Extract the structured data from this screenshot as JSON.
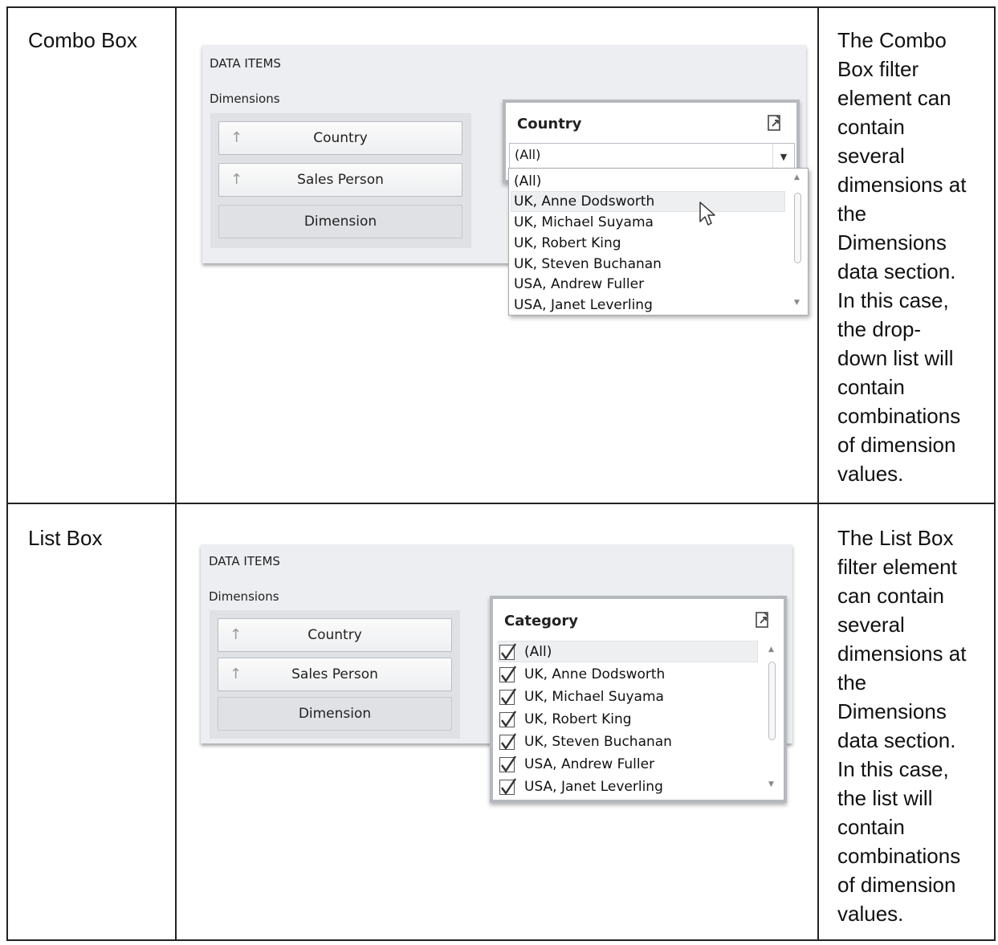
{
  "rows": [
    {
      "name": "Combo Box",
      "description": "The Combo Box filter element can contain several dimensions at the Dimensions data section. In this case, the drop-down list will contain combinations of dimension values.",
      "description_lines": [
        "The Combo",
        "Box filter",
        "element can",
        "contain",
        "several",
        "dimensions at",
        "the",
        "Dimensions",
        "data section.",
        "In this case,",
        "the drop-",
        "down list will",
        "contain",
        "combinations",
        "of dimension",
        "values."
      ],
      "panel": {
        "data_items_title": "DATA ITEMS",
        "dimensions_label": "Dimensions",
        "dimension_buttons": [
          "Country",
          "Sales Person"
        ],
        "dimension_placeholder": "Dimension",
        "filter_title": "Country",
        "selected_value": "(All)",
        "items": [
          "(All)",
          "UK, Anne Dodsworth",
          "UK, Michael Suyama",
          "UK, Robert King",
          "UK, Steven Buchanan",
          "USA, Andrew Fuller",
          "USA, Janet Leverling"
        ],
        "highlighted_item": "UK, Anne Dodsworth",
        "icons": [
          "arrow-up-icon",
          "export-icon",
          "dropdown-arrow-icon",
          "mouse-cursor-icon"
        ]
      }
    },
    {
      "name": "List Box",
      "description": "The List Box filter element can contain several dimensions at the Dimensions data section. In this case, the list will contain combinations of dimension values.",
      "description_lines": [
        "The List Box",
        "filter element",
        "can contain",
        "several",
        "dimensions at",
        "the",
        "Dimensions",
        "data section.",
        "In this case,",
        "the list will",
        "contain",
        "combinations",
        "of dimension",
        "values."
      ],
      "panel": {
        "data_items_title": "DATA ITEMS",
        "dimensions_label": "Dimensions",
        "dimension_buttons": [
          "Country",
          "Sales Person"
        ],
        "dimension_placeholder": "Dimension",
        "filter_title": "Category",
        "items": [
          "(All)",
          "UK, Anne Dodsworth",
          "UK, Michael Suyama",
          "UK, Robert King",
          "UK, Steven Buchanan",
          "USA, Andrew Fuller",
          "USA, Janet Leverling"
        ],
        "checked": [
          true,
          true,
          true,
          true,
          true,
          true,
          true
        ],
        "icons": [
          "arrow-up-icon",
          "export-icon",
          "checkbox-checked-icon"
        ]
      }
    }
  ]
}
